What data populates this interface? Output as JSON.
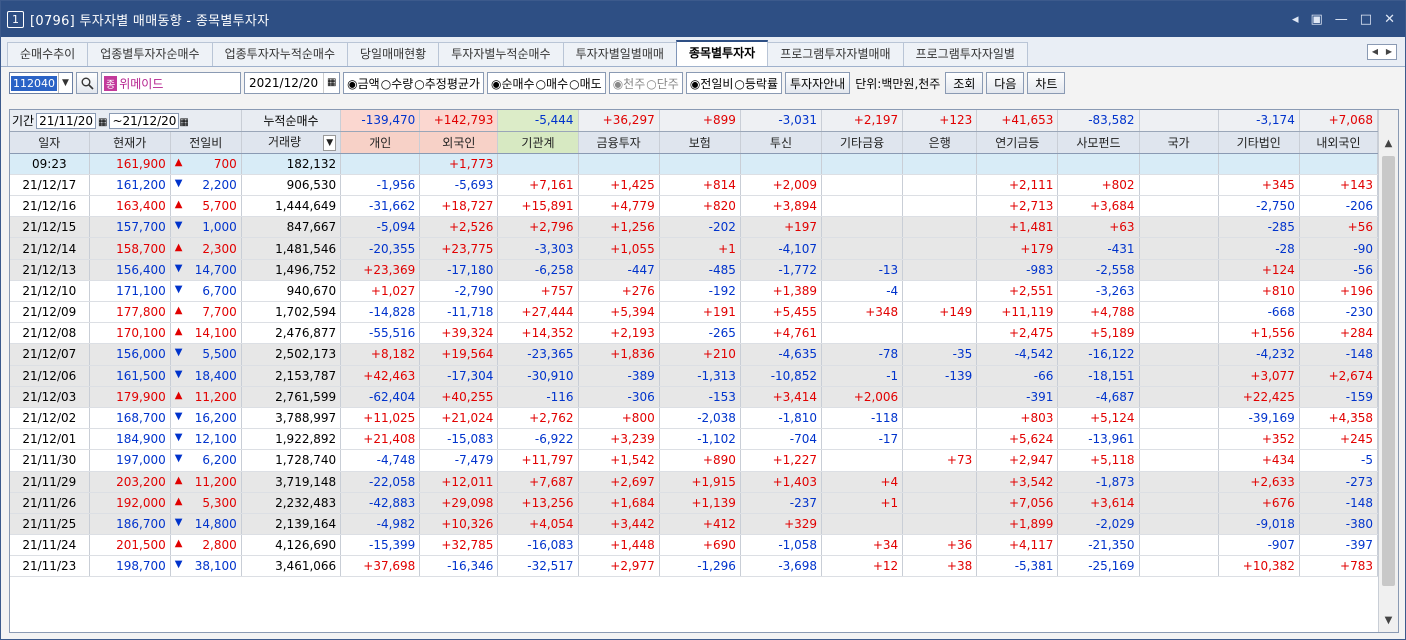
{
  "window": {
    "number": "1",
    "title": "[0796] 투자자별 매매동향 - 종목별투자자",
    "controls": [
      "◂",
      "▣",
      "—",
      "□",
      "✕"
    ]
  },
  "tabs": [
    "순매수추이",
    "업종별투자자순매수",
    "업종투자자누적순매수",
    "당일매매현황",
    "투자자별누적순매수",
    "투자자별일별매매",
    "종목별투자자",
    "프로그램투자자별매매",
    "프로그램투자자일별"
  ],
  "active_tab": "종목별투자자",
  "toolbar": {
    "code": "112040",
    "badge": "종",
    "stock_name": "위메이드",
    "date": "2021/12/20",
    "radio1": {
      "items": [
        "◉금액",
        "○수량",
        "○추정평균가"
      ]
    },
    "radio2": {
      "items": [
        "◉순매수",
        "○매수",
        "○매도"
      ]
    },
    "radio3": {
      "items": [
        "◉천주",
        "○단주"
      ]
    },
    "radio4": {
      "items": [
        "◉전일비",
        "○등락률"
      ]
    },
    "guide_button": "투자자안내",
    "unit_label": "단위:백만원,천주",
    "buttons": [
      "조회",
      "다음",
      "차트"
    ]
  },
  "summary": {
    "period_label": "기간",
    "from_date": "21/11/20",
    "to_date": "~21/12/20",
    "cum_label": "누적순매수",
    "values": [
      "-139,470",
      "+142,793",
      "-5,444",
      "+36,297",
      "+899",
      "-3,031",
      "+2,197",
      "+123",
      "+41,653",
      "-83,582",
      "",
      "-3,174",
      "+7,068"
    ]
  },
  "columns": [
    "일자",
    "현재가",
    "전일비",
    "거래량",
    "개인",
    "외국인",
    "기관계",
    "금융투자",
    "보험",
    "투신",
    "기타금융",
    "은행",
    "연기금등",
    "사모펀드",
    "국가",
    "기타법인",
    "내외국인"
  ],
  "rows": [
    {
      "date": "09:23",
      "price": "161,900",
      "dir": "up",
      "chg": "700",
      "vol": "182,132",
      "v": [
        "",
        "+1,773",
        "",
        "",
        "",
        "",
        "",
        "",
        "",
        "",
        "",
        "",
        ""
      ],
      "today": true
    },
    {
      "date": "21/12/17",
      "price": "161,200",
      "dir": "dn",
      "chg": "2,200",
      "vol": "906,530",
      "v": [
        "-1,956",
        "-5,693",
        "+7,161",
        "+1,425",
        "+814",
        "+2,009",
        "",
        "",
        "+2,111",
        "+802",
        "",
        "+345",
        "+143"
      ]
    },
    {
      "date": "21/12/16",
      "price": "163,400",
      "dir": "up",
      "chg": "5,700",
      "vol": "1,444,649",
      "v": [
        "-31,662",
        "+18,727",
        "+15,891",
        "+4,779",
        "+820",
        "+3,894",
        "",
        "",
        "+2,713",
        "+3,684",
        "",
        "-2,750",
        "-206"
      ]
    },
    {
      "date": "21/12/15",
      "price": "157,700",
      "dir": "dn",
      "chg": "1,000",
      "vol": "847,667",
      "v": [
        "-5,094",
        "+2,526",
        "+2,796",
        "+1,256",
        "-202",
        "+197",
        "",
        "",
        "+1,481",
        "+63",
        "",
        "-285",
        "+56"
      ]
    },
    {
      "date": "21/12/14",
      "price": "158,700",
      "dir": "up",
      "chg": "2,300",
      "vol": "1,481,546",
      "v": [
        "-20,355",
        "+23,775",
        "-3,303",
        "+1,055",
        "+1",
        "-4,107",
        "",
        "",
        "+179",
        "-431",
        "",
        "-28",
        "-90"
      ]
    },
    {
      "date": "21/12/13",
      "price": "156,400",
      "dir": "dn",
      "chg": "14,700",
      "vol": "1,496,752",
      "v": [
        "+23,369",
        "-17,180",
        "-6,258",
        "-447",
        "-485",
        "-1,772",
        "-13",
        "",
        "-983",
        "-2,558",
        "",
        "+124",
        "-56"
      ]
    },
    {
      "date": "21/12/10",
      "price": "171,100",
      "dir": "dn",
      "chg": "6,700",
      "vol": "940,670",
      "v": [
        "+1,027",
        "-2,790",
        "+757",
        "+276",
        "-192",
        "+1,389",
        "-4",
        "",
        "+2,551",
        "-3,263",
        "",
        "+810",
        "+196"
      ]
    },
    {
      "date": "21/12/09",
      "price": "177,800",
      "dir": "up",
      "chg": "7,700",
      "vol": "1,702,594",
      "v": [
        "-14,828",
        "-11,718",
        "+27,444",
        "+5,394",
        "+191",
        "+5,455",
        "+348",
        "+149",
        "+11,119",
        "+4,788",
        "",
        "-668",
        "-230"
      ]
    },
    {
      "date": "21/12/08",
      "price": "170,100",
      "dir": "up",
      "chg": "14,100",
      "vol": "2,476,877",
      "v": [
        "-55,516",
        "+39,324",
        "+14,352",
        "+2,193",
        "-265",
        "+4,761",
        "",
        "",
        "+2,475",
        "+5,189",
        "",
        "+1,556",
        "+284"
      ]
    },
    {
      "date": "21/12/07",
      "price": "156,000",
      "dir": "dn",
      "chg": "5,500",
      "vol": "2,502,173",
      "v": [
        "+8,182",
        "+19,564",
        "-23,365",
        "+1,836",
        "+210",
        "-4,635",
        "-78",
        "-35",
        "-4,542",
        "-16,122",
        "",
        "-4,232",
        "-148"
      ]
    },
    {
      "date": "21/12/06",
      "price": "161,500",
      "dir": "dn",
      "chg": "18,400",
      "vol": "2,153,787",
      "v": [
        "+42,463",
        "-17,304",
        "-30,910",
        "-389",
        "-1,313",
        "-10,852",
        "-1",
        "-139",
        "-66",
        "-18,151",
        "",
        "+3,077",
        "+2,674"
      ]
    },
    {
      "date": "21/12/03",
      "price": "179,900",
      "dir": "up",
      "chg": "11,200",
      "vol": "2,761,599",
      "v": [
        "-62,404",
        "+40,255",
        "-116",
        "-306",
        "-153",
        "+3,414",
        "+2,006",
        "",
        "-391",
        "-4,687",
        "",
        "+22,425",
        "-159"
      ]
    },
    {
      "date": "21/12/02",
      "price": "168,700",
      "dir": "dn",
      "chg": "16,200",
      "vol": "3,788,997",
      "v": [
        "+11,025",
        "+21,024",
        "+2,762",
        "+800",
        "-2,038",
        "-1,810",
        "-118",
        "",
        "+803",
        "+5,124",
        "",
        "-39,169",
        "+4,358"
      ]
    },
    {
      "date": "21/12/01",
      "price": "184,900",
      "dir": "dn",
      "chg": "12,100",
      "vol": "1,922,892",
      "v": [
        "+21,408",
        "-15,083",
        "-6,922",
        "+3,239",
        "-1,102",
        "-704",
        "-17",
        "",
        "+5,624",
        "-13,961",
        "",
        "+352",
        "+245"
      ]
    },
    {
      "date": "21/11/30",
      "price": "197,000",
      "dir": "dn",
      "chg": "6,200",
      "vol": "1,728,740",
      "v": [
        "-4,748",
        "-7,479",
        "+11,797",
        "+1,542",
        "+890",
        "+1,227",
        "",
        "+73",
        "+2,947",
        "+5,118",
        "",
        "+434",
        "-5"
      ]
    },
    {
      "date": "21/11/29",
      "price": "203,200",
      "dir": "up",
      "chg": "11,200",
      "vol": "3,719,148",
      "v": [
        "-22,058",
        "+12,011",
        "+7,687",
        "+2,697",
        "+1,915",
        "+1,403",
        "+4",
        "",
        "+3,542",
        "-1,873",
        "",
        "+2,633",
        "-273"
      ]
    },
    {
      "date": "21/11/26",
      "price": "192,000",
      "dir": "up",
      "chg": "5,300",
      "vol": "2,232,483",
      "v": [
        "-42,883",
        "+29,098",
        "+13,256",
        "+1,684",
        "+1,139",
        "-237",
        "+1",
        "",
        "+7,056",
        "+3,614",
        "",
        "+676",
        "-148"
      ]
    },
    {
      "date": "21/11/25",
      "price": "186,700",
      "dir": "dn",
      "chg": "14,800",
      "vol": "2,139,164",
      "v": [
        "-4,982",
        "+10,326",
        "+4,054",
        "+3,442",
        "+412",
        "+329",
        "",
        "",
        "+1,899",
        "-2,029",
        "",
        "-9,018",
        "-380"
      ]
    },
    {
      "date": "21/11/24",
      "price": "201,500",
      "dir": "up",
      "chg": "2,800",
      "vol": "4,126,690",
      "v": [
        "-15,399",
        "+32,785",
        "-16,083",
        "+1,448",
        "+690",
        "-1,058",
        "+34",
        "+36",
        "+4,117",
        "-21,350",
        "",
        "-907",
        "-397"
      ]
    },
    {
      "date": "21/11/23",
      "price": "198,700",
      "dir": "dn",
      "chg": "38,100",
      "vol": "3,461,066",
      "v": [
        "+37,698",
        "-16,346",
        "-32,517",
        "+2,977",
        "-1,296",
        "-3,698",
        "+12",
        "+38",
        "-5,381",
        "-25,169",
        "",
        "+10,382",
        "+783"
      ]
    }
  ],
  "colors": {
    "up": "#e10000",
    "down": "#0033cc",
    "title_bar": "#2e4f84"
  },
  "icons": {
    "search": "search-icon",
    "calendar": "calendar-icon",
    "sort": "sort-down-icon"
  }
}
